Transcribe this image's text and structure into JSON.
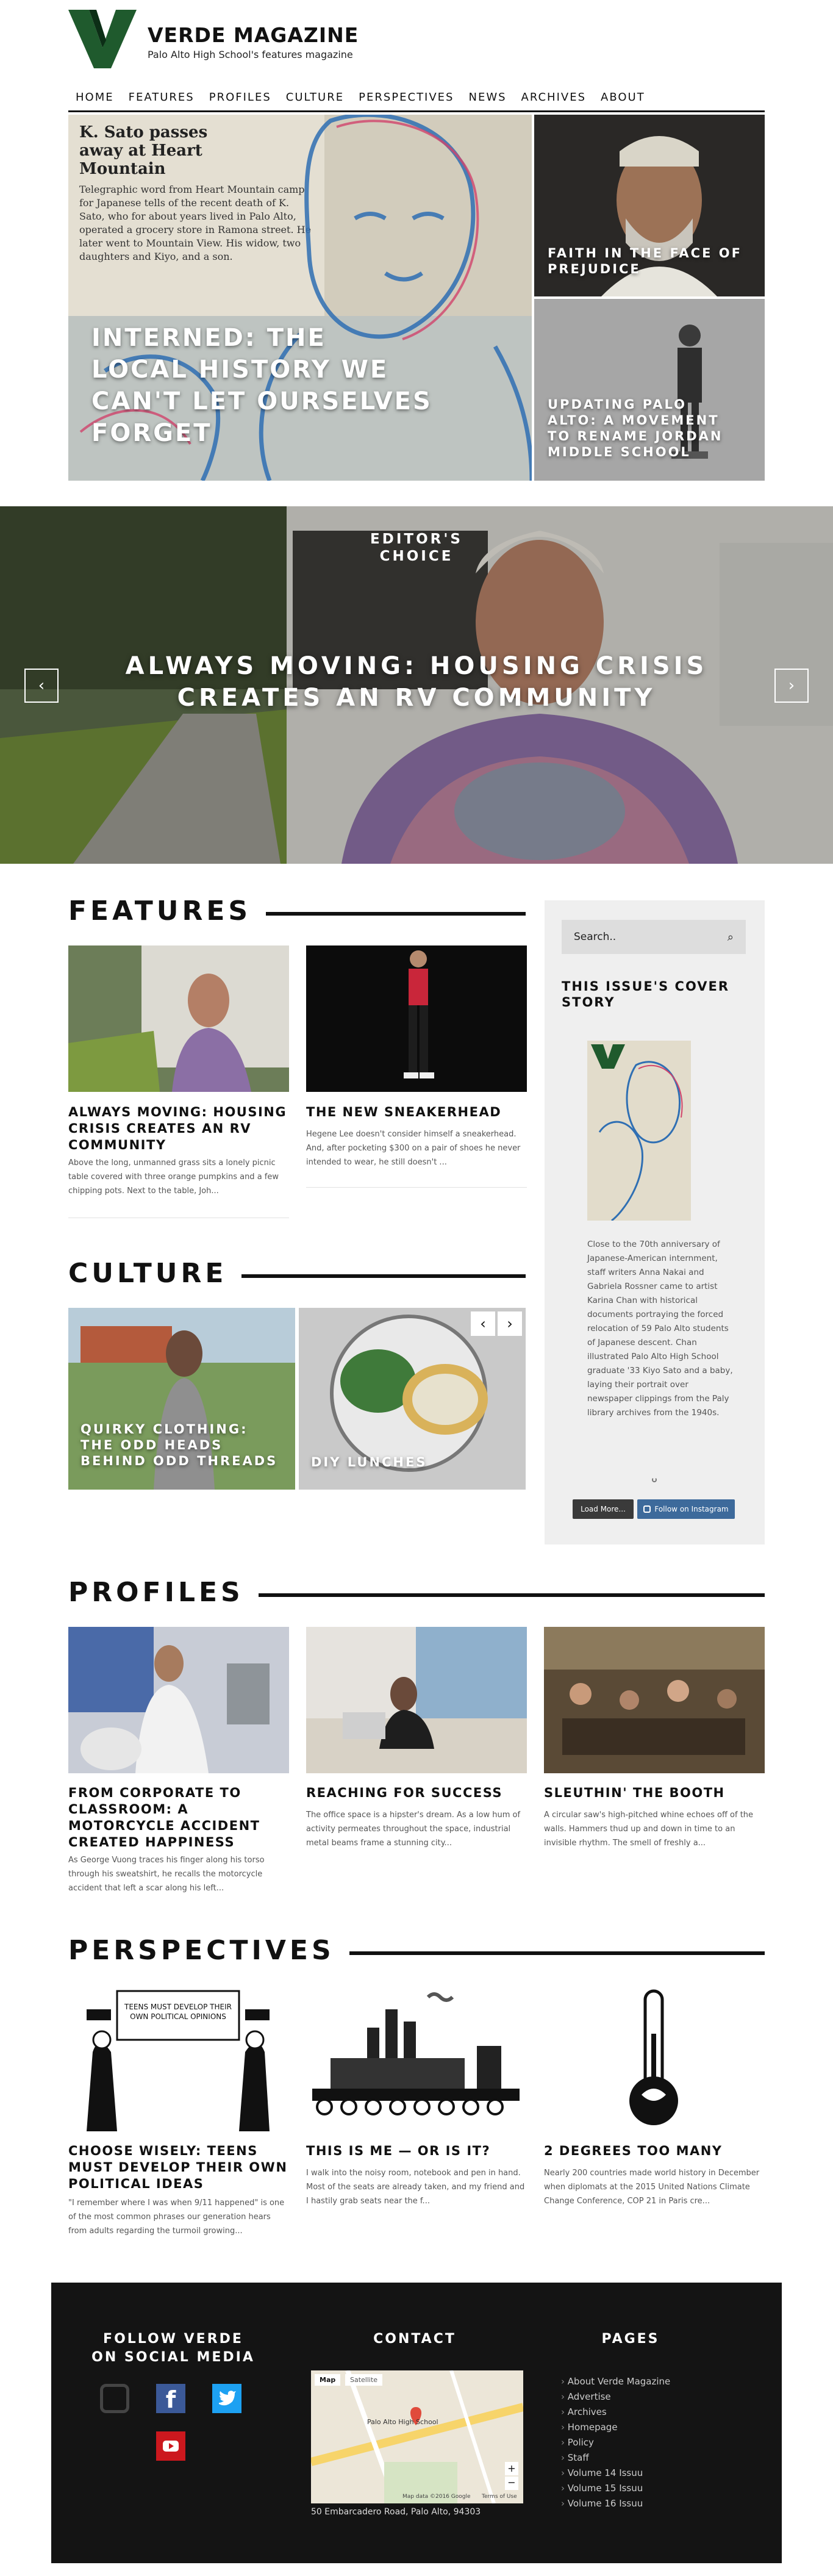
{
  "header": {
    "site_title": "VERDE MAGAZINE",
    "tagline": "Palo Alto High School's features magazine",
    "nav": [
      "HOME",
      "FEATURES",
      "PROFILES",
      "CULTURE",
      "PERSPECTIVES",
      "NEWS",
      "ARCHIVES",
      "ABOUT"
    ]
  },
  "hero": {
    "main_title": "INTERNED: THE LOCAL HISTORY WE CAN'T LET OURSELVES FORGET",
    "clip_headline": "K. Sato passes away at Heart Mountain",
    "clip_body": "Telegraphic word from Heart Mountain camp for Japanese tells of the recent death of K. Sato, who for about years lived in Palo Alto, operated a grocery store in Ramona street. He later went to Mountain View. His widow, two daughters and Kiyo, and a son.",
    "top_right_title": "FAITH IN THE FACE OF PREJUDICE",
    "bottom_right_title": "UPDATING PALO ALTO: A MOVEMENT TO RENAME JORDAN MIDDLE SCHOOL"
  },
  "slider": {
    "kicker": "EDITOR'S CHOICE",
    "title": "ALWAYS MOVING: HOUSING CRISIS CREATES AN RV COMMUNITY",
    "prev": "‹",
    "next": "›"
  },
  "features": {
    "heading": "FEATURES",
    "items": [
      {
        "title": "ALWAYS MOVING: HOUSING CRISIS CREATES AN RV COMMUNITY",
        "excerpt": "Above the long, unmanned grass sits a lonely picnic table covered with three orange pumpkins and a few chipping pots.  Next to the table, Joh..."
      },
      {
        "title": "THE NEW SNEAKERHEAD",
        "excerpt": "Hegene Lee doesn't consider himself a sneakerhead. And, after pocketing $300 on a pair of shoes he never intended to wear, he still doesn't ..."
      }
    ]
  },
  "culture": {
    "heading": "CULTURE",
    "items": [
      {
        "title": "QUIRKY CLOTHING: THE ODD HEADS BEHIND ODD THREADS"
      },
      {
        "title": "DIY LUNCHES"
      }
    ],
    "prev": "‹",
    "next": "›"
  },
  "sidebar": {
    "search_placeholder": "Search..",
    "cover_heading": "THIS ISSUE'S COVER STORY",
    "cover_caption": "Close to the 70th anniversary of Japanese-American internment, staff writers Anna Nakai and Gabriela Rossner came to artist Karina Chan with historical documents portraying the forced relocation of 59 Palo Alto students of Japanese descent. Chan illustrated Palo Alto High School graduate '33 Kiyo Sato and a baby, laying their portrait over newspaper clippings from the Paly library archives from the 1940s.",
    "load_more": "Load More...",
    "follow": "Follow on Instagram"
  },
  "profiles": {
    "heading": "PROFILES",
    "items": [
      {
        "title": "FROM CORPORATE TO CLASSROOM: A MOTORCYCLE ACCIDENT CREATED HAPPINESS",
        "excerpt": "As George Vuong traces his finger along his torso through his sweatshirt, he recalls the motorcycle accident that left a scar along his left..."
      },
      {
        "title": "REACHING FOR SUCCESS",
        "excerpt": "The office space is a hipster's dream. As a low hum of activity permeates throughout the space, industrial metal beams frame a stunning city..."
      },
      {
        "title": "SLEUTHIN' THE BOOTH",
        "excerpt": "A circular saw's high-pitched whine echoes off of the walls. Hammers thud up and down in time to an invisible rhythm. The smell of freshly a..."
      }
    ]
  },
  "perspectives": {
    "heading": "PERSPECTIVES",
    "cartoon_caption": "TEENS MUST DEVELOP THEIR OWN POLITICAL OPINIONS",
    "items": [
      {
        "title": "CHOOSE WISELY: TEENS MUST DEVELOP THEIR OWN POLITICAL IDEAS",
        "excerpt": "\"I remember where I was when 9/11 happened\" is one of the most common phrases our generation hears from adults regarding the turmoil growing..."
      },
      {
        "title": "THIS IS ME — OR IS IT?",
        "excerpt": "I walk into the noisy room, notebook and pen in hand. Most of the seats are already taken, and my friend and I hastily grab seats near the f..."
      },
      {
        "title": "2 DEGREES TOO MANY",
        "excerpt": "Nearly 200 countries made world history in December when diplomats at the 2015 United Nations Climate Change Conference, COP 21 in Paris cre..."
      }
    ]
  },
  "footer": {
    "social_heading": "FOLLOW VERDE ON SOCIAL MEDIA",
    "contact_heading": "CONTACT",
    "pages_heading": "PAGES",
    "map_tabs": [
      "Map",
      "Satellite"
    ],
    "map_label": "Palo Alto High School",
    "map_credit": "Map data ©2016 Google",
    "map_terms": "Terms of Use",
    "address": "50 Embarcadero Road, Palo Alto, 94303",
    "pages": [
      "About Verde Magazine",
      "Advertise",
      "Archives",
      "Homepage",
      "Policy",
      "Staff",
      "Volume 14 Issuu",
      "Volume 15 Issuu",
      "Volume 16 Issuu"
    ]
  },
  "colors": {
    "brand_green": "#1f5a2d",
    "dark": "#141414",
    "instagram_blue": "#3d6a9b",
    "facebook": "#3b5998",
    "twitter": "#1da1f2",
    "youtube": "#cc181e"
  }
}
